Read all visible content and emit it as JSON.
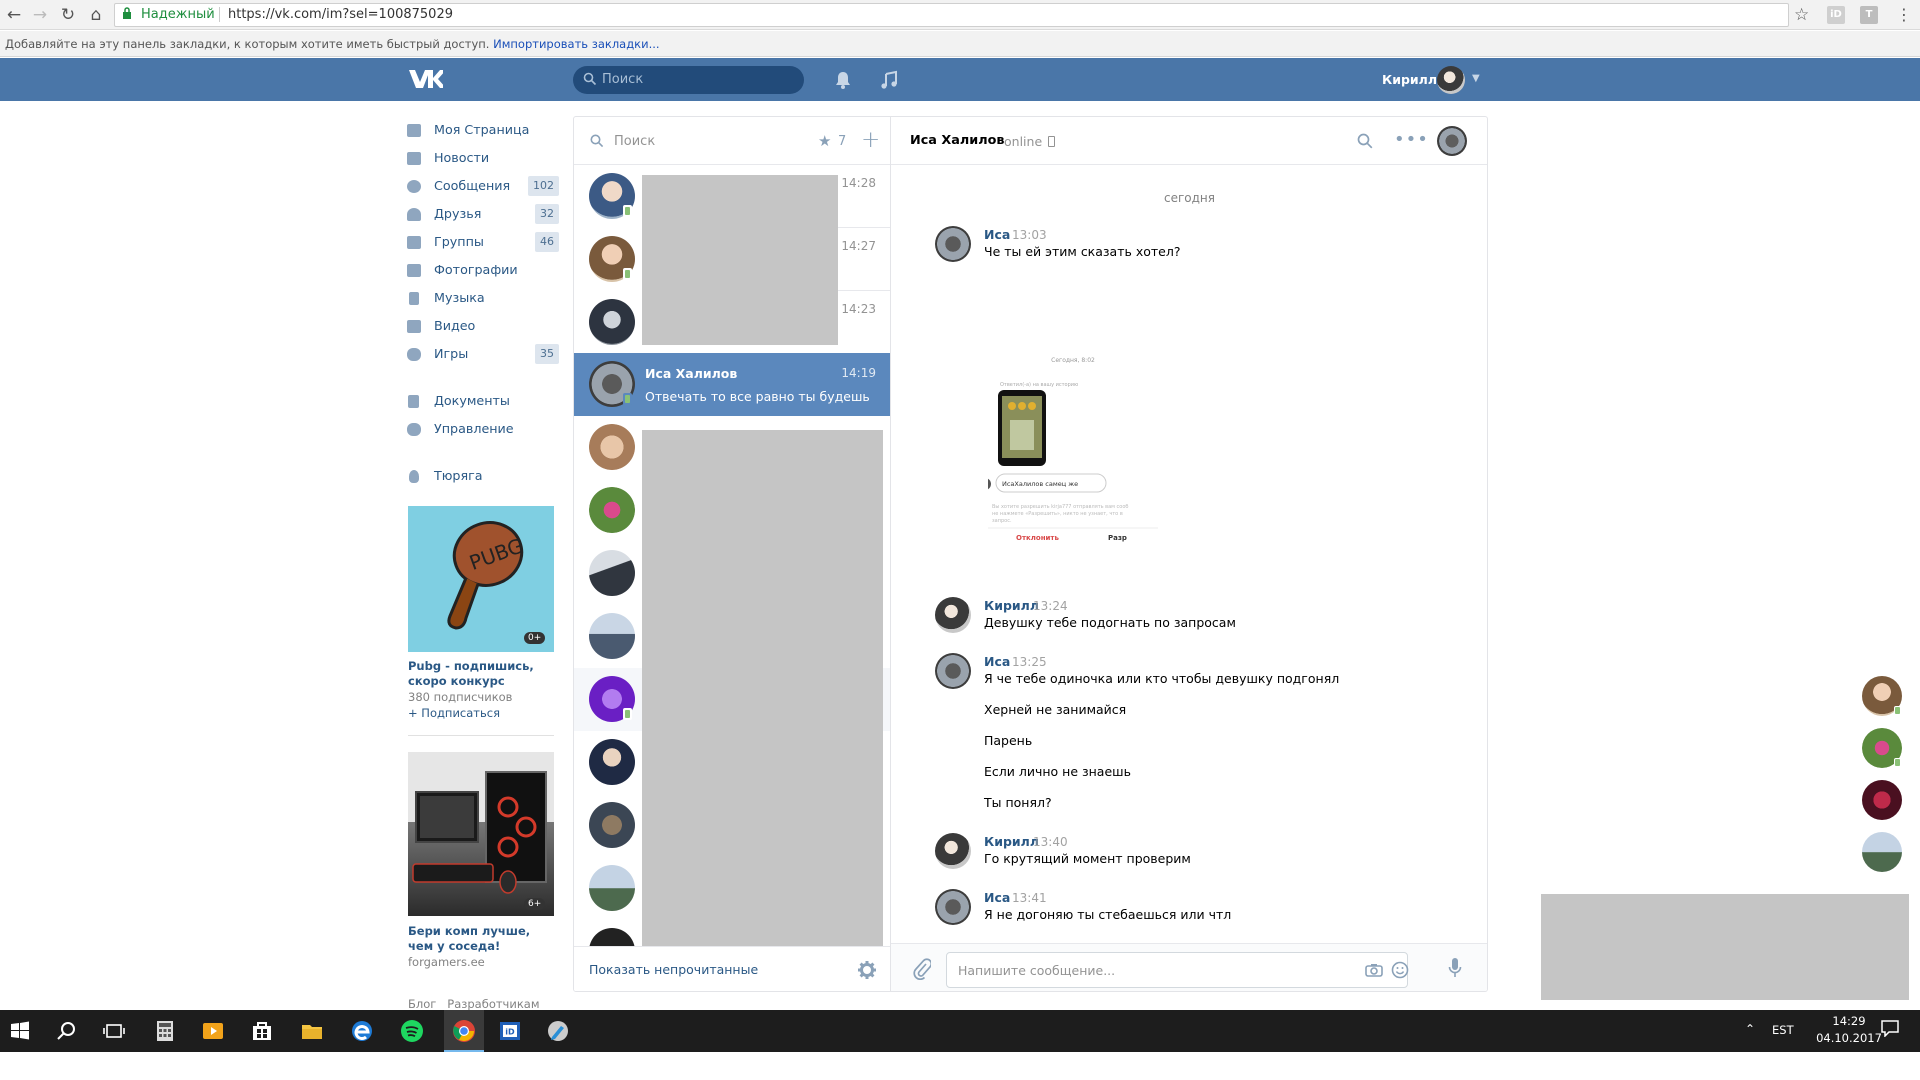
{
  "browser": {
    "secure_label": "Надежный",
    "url": "https://vk.com/im?sel=100875029",
    "bookmarks_hint": "Добавляйте на эту панель закладки, к которым хотите иметь быстрый доступ.",
    "bookmarks_link": "Импортировать закладки...",
    "extensions": [
      "iD",
      "T"
    ]
  },
  "header": {
    "search_placeholder": "Поиск",
    "user_name": "Кирилл",
    "brand_color": "#4a76a8"
  },
  "left_menu": {
    "items": [
      {
        "label": "Моя Страница",
        "count": "",
        "icon": "home-icon"
      },
      {
        "label": "Новости",
        "count": "",
        "icon": "news-icon"
      },
      {
        "label": "Сообщения",
        "count": "102",
        "icon": "messages-icon"
      },
      {
        "label": "Друзья",
        "count": "32",
        "icon": "friends-icon"
      },
      {
        "label": "Группы",
        "count": "46",
        "icon": "groups-icon"
      },
      {
        "label": "Фотографии",
        "count": "",
        "icon": "camera-icon"
      },
      {
        "label": "Музыка",
        "count": "",
        "icon": "music-note-icon"
      },
      {
        "label": "Видео",
        "count": "",
        "icon": "film-icon"
      },
      {
        "label": "Игры",
        "count": "35",
        "icon": "gamepad-icon"
      },
      {
        "label": "Документы",
        "count": "",
        "icon": "document-icon"
      },
      {
        "label": "Управление",
        "count": "",
        "icon": "gamepad-icon"
      },
      {
        "label": "Тюряга",
        "count": "",
        "icon": "anchor-icon"
      }
    ]
  },
  "ads": [
    {
      "image_text": "PUBG",
      "age": "0+",
      "title": "Pubg - подпишись, скоро конкурс",
      "subscribers": "380 подписчиков",
      "action": "+ Подписаться"
    },
    {
      "age": "6+",
      "title": "Бери комп лучше, чем у соседа!",
      "domain": "forgamers.ee"
    }
  ],
  "footer_links": "Блог   Разработчикам",
  "dialogs": {
    "search_placeholder": "Поиск",
    "starred_count": "7",
    "times": [
      "14:28",
      "14:27",
      "14:23"
    ],
    "selected": {
      "name": "Иса Халилов",
      "time": "14:19",
      "text": "Отвечать то все равно ты будешь"
    },
    "show_unread": "Показать непрочитанные"
  },
  "chat": {
    "peer_name": "Иса Халилов",
    "peer_status": "online",
    "day": "сегодня",
    "screenshot_card": {
      "reply_button": "Отклонить",
      "accept_button": "Разр",
      "bubble": "ИсаХалилов самец же",
      "time": "Сегодня, 8:02"
    },
    "messages": [
      {
        "author": "Иса",
        "time": "13:03",
        "lines": [
          "Че ты ей этим сказать хотел?"
        ]
      },
      {
        "author": "Кирилл",
        "time": "13:24",
        "lines": [
          "Девушку тебе подогнать по запросам"
        ]
      },
      {
        "author": "Иса",
        "time": "13:25",
        "lines": [
          "Я че тебе одиночка или кто чтобы девушку подгонял",
          "Херней не занимайся",
          "Парень",
          "Если лично не знаешь",
          "Ты понял?"
        ]
      },
      {
        "author": "Кирилл",
        "time": "13:40",
        "lines": [
          "Го крутящий момент проверим"
        ]
      },
      {
        "author": "Иса",
        "time": "13:41",
        "lines": [
          "Я не догоняю ты стебаешься или чтл"
        ]
      }
    ],
    "input_placeholder": "Напишите сообщение..."
  },
  "taskbar": {
    "lang": "EST",
    "time": "14:29",
    "date": "04.10.2017"
  }
}
